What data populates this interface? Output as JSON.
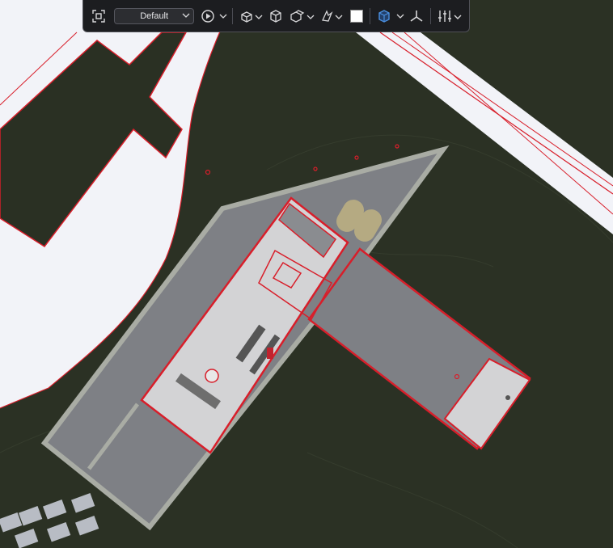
{
  "toolbar": {
    "preset_label": "Default",
    "tools": [
      {
        "name": "zoom-extents-icon"
      },
      {
        "name": "play-icon"
      },
      {
        "name": "view-cube-icon"
      },
      {
        "name": "box-view-icon"
      },
      {
        "name": "section-box-icon"
      },
      {
        "name": "visual-style-icon"
      },
      {
        "name": "background-color-swatch",
        "color": "#ffffff"
      },
      {
        "name": "orbit-navigation-icon",
        "color": "#4a8fe0"
      },
      {
        "name": "axes-icon"
      },
      {
        "name": "settings-sliders-icon"
      }
    ]
  },
  "scene": {
    "terrain_color": "#2b3124",
    "road_color": "#f2f3f8",
    "outline_color": "#d81e2a",
    "slab_color": "#7e8085",
    "floor_color": "#d3d3d5"
  }
}
